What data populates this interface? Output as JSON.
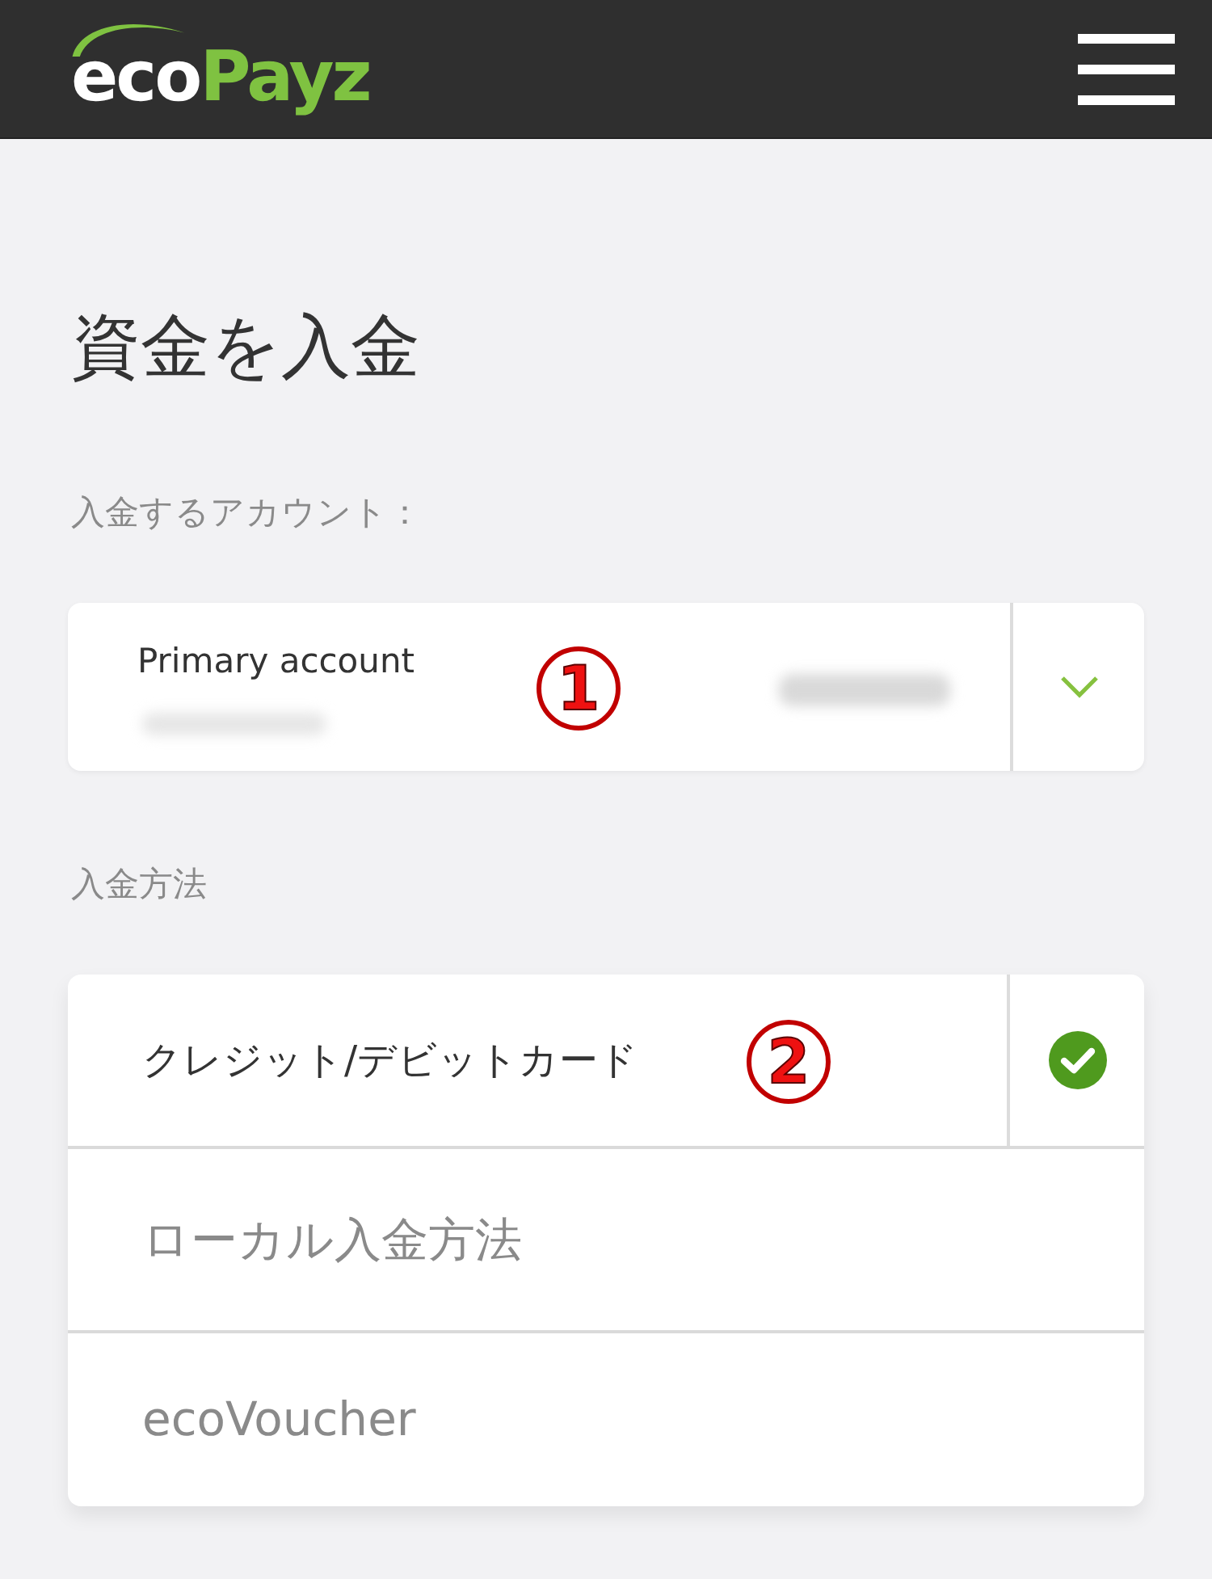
{
  "header": {
    "logo": {
      "text_1": "eco",
      "text_2": "Payz"
    }
  },
  "page_title": "資金を入金",
  "account_section": {
    "label": "入金するアカウント：",
    "account": {
      "name": "Primary account",
      "marker": "1"
    }
  },
  "method_section": {
    "label": "入金方法",
    "methods": [
      {
        "label": "クレジット/デビットカード",
        "selected": true,
        "marker": "2"
      },
      {
        "label": "ローカル入金方法",
        "selected": false
      },
      {
        "label": "ecoVoucher",
        "selected": false
      }
    ]
  }
}
